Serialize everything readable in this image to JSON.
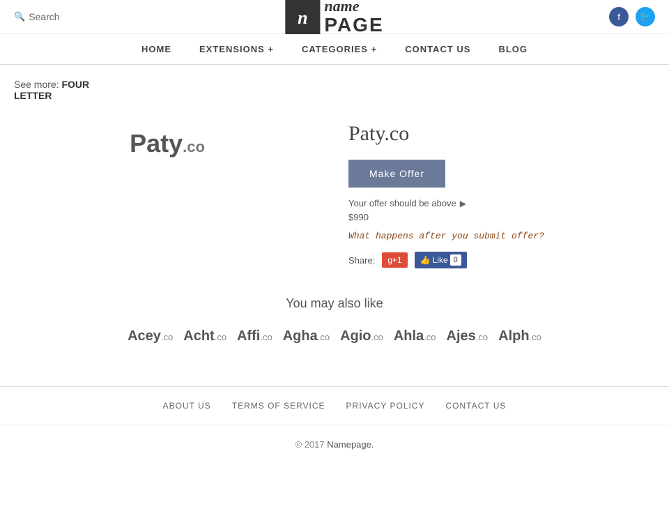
{
  "header": {
    "search_label": "Search",
    "logo_icon_char": "n",
    "logo_name": "name",
    "logo_page": "PAGE",
    "facebook_icon": "f",
    "twitter_icon": "t"
  },
  "nav": {
    "items": [
      {
        "label": "HOME",
        "id": "home"
      },
      {
        "label": "EXTENSIONS +",
        "id": "extensions"
      },
      {
        "label": "CATEGORIES +",
        "id": "categories"
      },
      {
        "label": "CONTACT US",
        "id": "contact"
      },
      {
        "label": "BLOG",
        "id": "blog"
      }
    ]
  },
  "breadcrumb": {
    "see_more_label": "See more:",
    "link_line1": "FOUR",
    "link_line2": "LETTER"
  },
  "domain": {
    "display_name": "Paty",
    "extension": ".co",
    "full_name": "Paty.co",
    "make_offer_label": "Make Offer",
    "offer_hint": "Your offer should be above",
    "offer_price": "$990",
    "submit_link_text": "What happens after you submit offer?",
    "share_label": "Share:",
    "gplus_label": "g+1",
    "fb_like_label": "Like",
    "fb_count": "0"
  },
  "also_like": {
    "title": "You may also like",
    "domains": [
      {
        "name": "Acey",
        "ext": ".co"
      },
      {
        "name": "Acht",
        "ext": ".co"
      },
      {
        "name": "Affi",
        "ext": ".co"
      },
      {
        "name": "Agha",
        "ext": ".co"
      },
      {
        "name": "Agio",
        "ext": ".co"
      },
      {
        "name": "Ahla",
        "ext": ".co"
      },
      {
        "name": "Ajes",
        "ext": ".co"
      },
      {
        "name": "Alph",
        "ext": ".co"
      }
    ]
  },
  "footer": {
    "links": [
      {
        "label": "ABOUT US",
        "id": "about-us"
      },
      {
        "label": "TERMS OF SERVICE",
        "id": "terms"
      },
      {
        "label": "PRIVACY POLICY",
        "id": "privacy"
      },
      {
        "label": "CONTACT US",
        "id": "contact"
      }
    ],
    "copy_text": "© 2017",
    "copy_link_text": "Namepage.",
    "copy_period": ""
  }
}
